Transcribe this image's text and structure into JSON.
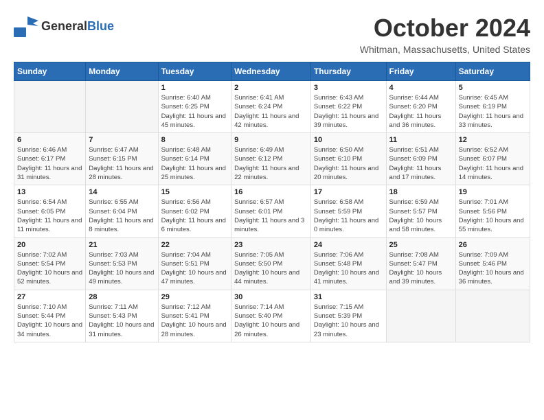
{
  "logo": {
    "general": "General",
    "blue": "Blue"
  },
  "title": {
    "month": "October 2024",
    "location": "Whitman, Massachusetts, United States"
  },
  "weekdays": [
    "Sunday",
    "Monday",
    "Tuesday",
    "Wednesday",
    "Thursday",
    "Friday",
    "Saturday"
  ],
  "weeks": [
    [
      {
        "day": "",
        "info": ""
      },
      {
        "day": "",
        "info": ""
      },
      {
        "day": "1",
        "info": "Sunrise: 6:40 AM\nSunset: 6:25 PM\nDaylight: 11 hours and 45 minutes."
      },
      {
        "day": "2",
        "info": "Sunrise: 6:41 AM\nSunset: 6:24 PM\nDaylight: 11 hours and 42 minutes."
      },
      {
        "day": "3",
        "info": "Sunrise: 6:43 AM\nSunset: 6:22 PM\nDaylight: 11 hours and 39 minutes."
      },
      {
        "day": "4",
        "info": "Sunrise: 6:44 AM\nSunset: 6:20 PM\nDaylight: 11 hours and 36 minutes."
      },
      {
        "day": "5",
        "info": "Sunrise: 6:45 AM\nSunset: 6:19 PM\nDaylight: 11 hours and 33 minutes."
      }
    ],
    [
      {
        "day": "6",
        "info": "Sunrise: 6:46 AM\nSunset: 6:17 PM\nDaylight: 11 hours and 31 minutes."
      },
      {
        "day": "7",
        "info": "Sunrise: 6:47 AM\nSunset: 6:15 PM\nDaylight: 11 hours and 28 minutes."
      },
      {
        "day": "8",
        "info": "Sunrise: 6:48 AM\nSunset: 6:14 PM\nDaylight: 11 hours and 25 minutes."
      },
      {
        "day": "9",
        "info": "Sunrise: 6:49 AM\nSunset: 6:12 PM\nDaylight: 11 hours and 22 minutes."
      },
      {
        "day": "10",
        "info": "Sunrise: 6:50 AM\nSunset: 6:10 PM\nDaylight: 11 hours and 20 minutes."
      },
      {
        "day": "11",
        "info": "Sunrise: 6:51 AM\nSunset: 6:09 PM\nDaylight: 11 hours and 17 minutes."
      },
      {
        "day": "12",
        "info": "Sunrise: 6:52 AM\nSunset: 6:07 PM\nDaylight: 11 hours and 14 minutes."
      }
    ],
    [
      {
        "day": "13",
        "info": "Sunrise: 6:54 AM\nSunset: 6:05 PM\nDaylight: 11 hours and 11 minutes."
      },
      {
        "day": "14",
        "info": "Sunrise: 6:55 AM\nSunset: 6:04 PM\nDaylight: 11 hours and 8 minutes."
      },
      {
        "day": "15",
        "info": "Sunrise: 6:56 AM\nSunset: 6:02 PM\nDaylight: 11 hours and 6 minutes."
      },
      {
        "day": "16",
        "info": "Sunrise: 6:57 AM\nSunset: 6:01 PM\nDaylight: 11 hours and 3 minutes."
      },
      {
        "day": "17",
        "info": "Sunrise: 6:58 AM\nSunset: 5:59 PM\nDaylight: 11 hours and 0 minutes."
      },
      {
        "day": "18",
        "info": "Sunrise: 6:59 AM\nSunset: 5:57 PM\nDaylight: 10 hours and 58 minutes."
      },
      {
        "day": "19",
        "info": "Sunrise: 7:01 AM\nSunset: 5:56 PM\nDaylight: 10 hours and 55 minutes."
      }
    ],
    [
      {
        "day": "20",
        "info": "Sunrise: 7:02 AM\nSunset: 5:54 PM\nDaylight: 10 hours and 52 minutes."
      },
      {
        "day": "21",
        "info": "Sunrise: 7:03 AM\nSunset: 5:53 PM\nDaylight: 10 hours and 49 minutes."
      },
      {
        "day": "22",
        "info": "Sunrise: 7:04 AM\nSunset: 5:51 PM\nDaylight: 10 hours and 47 minutes."
      },
      {
        "day": "23",
        "info": "Sunrise: 7:05 AM\nSunset: 5:50 PM\nDaylight: 10 hours and 44 minutes."
      },
      {
        "day": "24",
        "info": "Sunrise: 7:06 AM\nSunset: 5:48 PM\nDaylight: 10 hours and 41 minutes."
      },
      {
        "day": "25",
        "info": "Sunrise: 7:08 AM\nSunset: 5:47 PM\nDaylight: 10 hours and 39 minutes."
      },
      {
        "day": "26",
        "info": "Sunrise: 7:09 AM\nSunset: 5:46 PM\nDaylight: 10 hours and 36 minutes."
      }
    ],
    [
      {
        "day": "27",
        "info": "Sunrise: 7:10 AM\nSunset: 5:44 PM\nDaylight: 10 hours and 34 minutes."
      },
      {
        "day": "28",
        "info": "Sunrise: 7:11 AM\nSunset: 5:43 PM\nDaylight: 10 hours and 31 minutes."
      },
      {
        "day": "29",
        "info": "Sunrise: 7:12 AM\nSunset: 5:41 PM\nDaylight: 10 hours and 28 minutes."
      },
      {
        "day": "30",
        "info": "Sunrise: 7:14 AM\nSunset: 5:40 PM\nDaylight: 10 hours and 26 minutes."
      },
      {
        "day": "31",
        "info": "Sunrise: 7:15 AM\nSunset: 5:39 PM\nDaylight: 10 hours and 23 minutes."
      },
      {
        "day": "",
        "info": ""
      },
      {
        "day": "",
        "info": ""
      }
    ]
  ]
}
